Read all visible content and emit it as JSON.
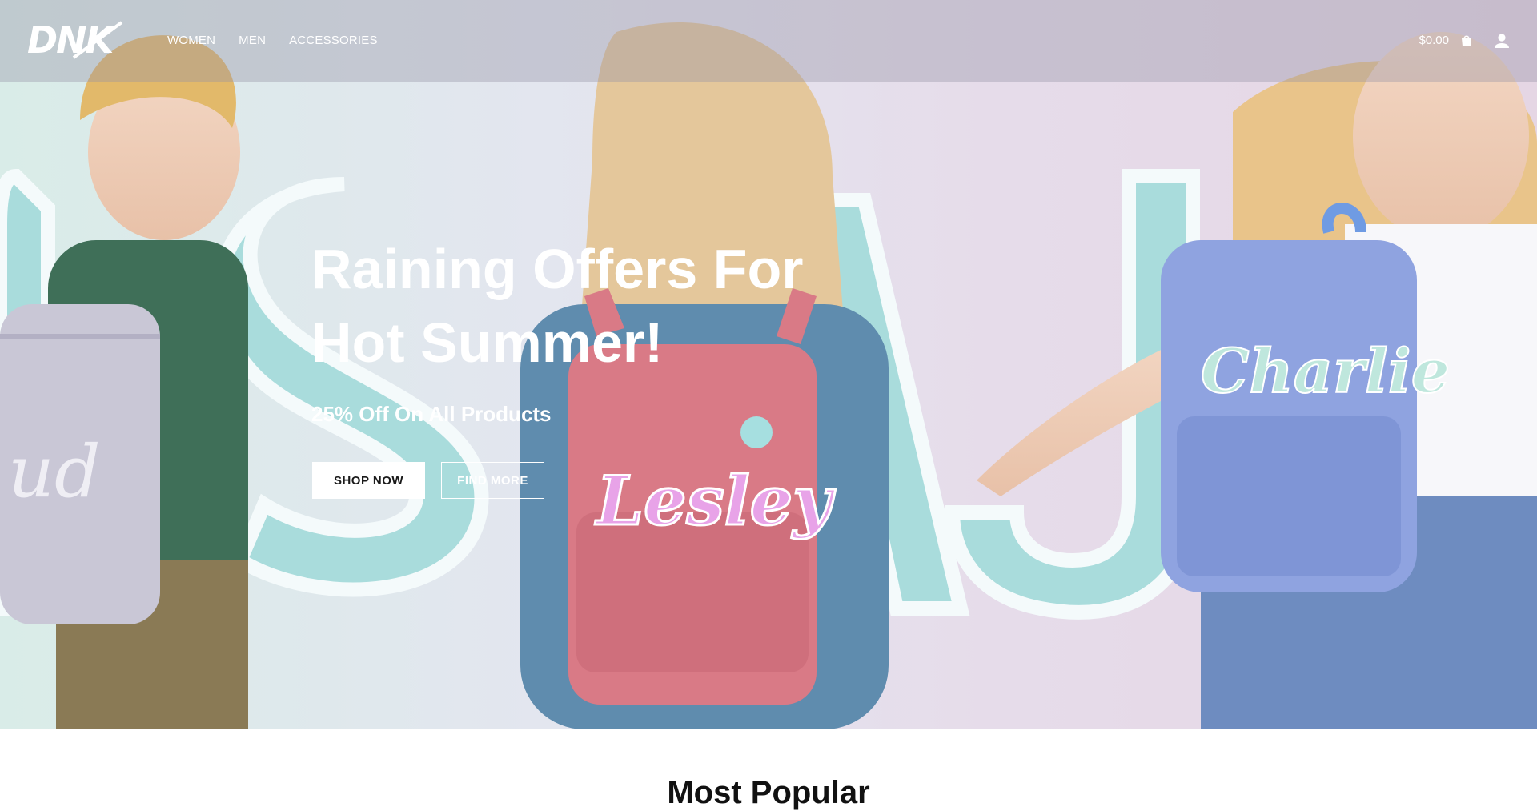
{
  "brand": {
    "logo_text": "DNK"
  },
  "nav": {
    "items": [
      {
        "label": "WOMEN"
      },
      {
        "label": "MEN"
      },
      {
        "label": "ACCESSORIES"
      }
    ]
  },
  "header": {
    "cart_total": "$0.00",
    "cart_icon": "shopping-bag-icon",
    "account_icon": "user-icon"
  },
  "hero": {
    "title_line1": "Raining Offers For",
    "title_line2": "Hot Summer!",
    "subtitle": "25% Off On All Products",
    "primary_button": "SHOP NOW",
    "secondary_button": "FIND MORE",
    "background_names": [
      "Lesley",
      "Charlie",
      "ud"
    ]
  },
  "section": {
    "title": "Most Popular"
  },
  "colors": {
    "accent_teal": "#a9dcdc",
    "pink_backpack": "#d97a86",
    "blue_backpack": "#8fa3e0",
    "grey_backpack": "#c9c7d6"
  }
}
